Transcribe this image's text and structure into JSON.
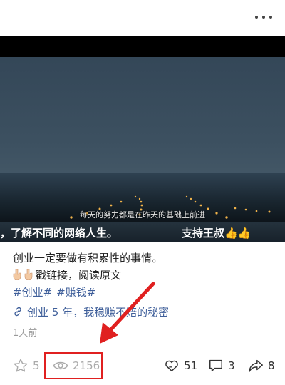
{
  "video": {
    "subtitle": "每天的努力都是在昨天的基础上前进",
    "ticker_left": "，了解不同的网络人生。",
    "ticker_right": "支持王叔👍👍"
  },
  "post": {
    "line1": "创业一定要做有积累性的事情。",
    "line2": "戳链接，阅读原文",
    "topics": [
      "#创业#",
      "#赚钱#"
    ],
    "link_text": "创业 5 年，我稳赚不赔的秘密",
    "time": "1天前"
  },
  "actions": {
    "favorite_count": "5",
    "views_count": "2156",
    "likes_count": "51",
    "comments_count": "3",
    "shares_count": "8"
  },
  "colors": {
    "link": "#3f5f9a",
    "highlight": "#e02020"
  }
}
